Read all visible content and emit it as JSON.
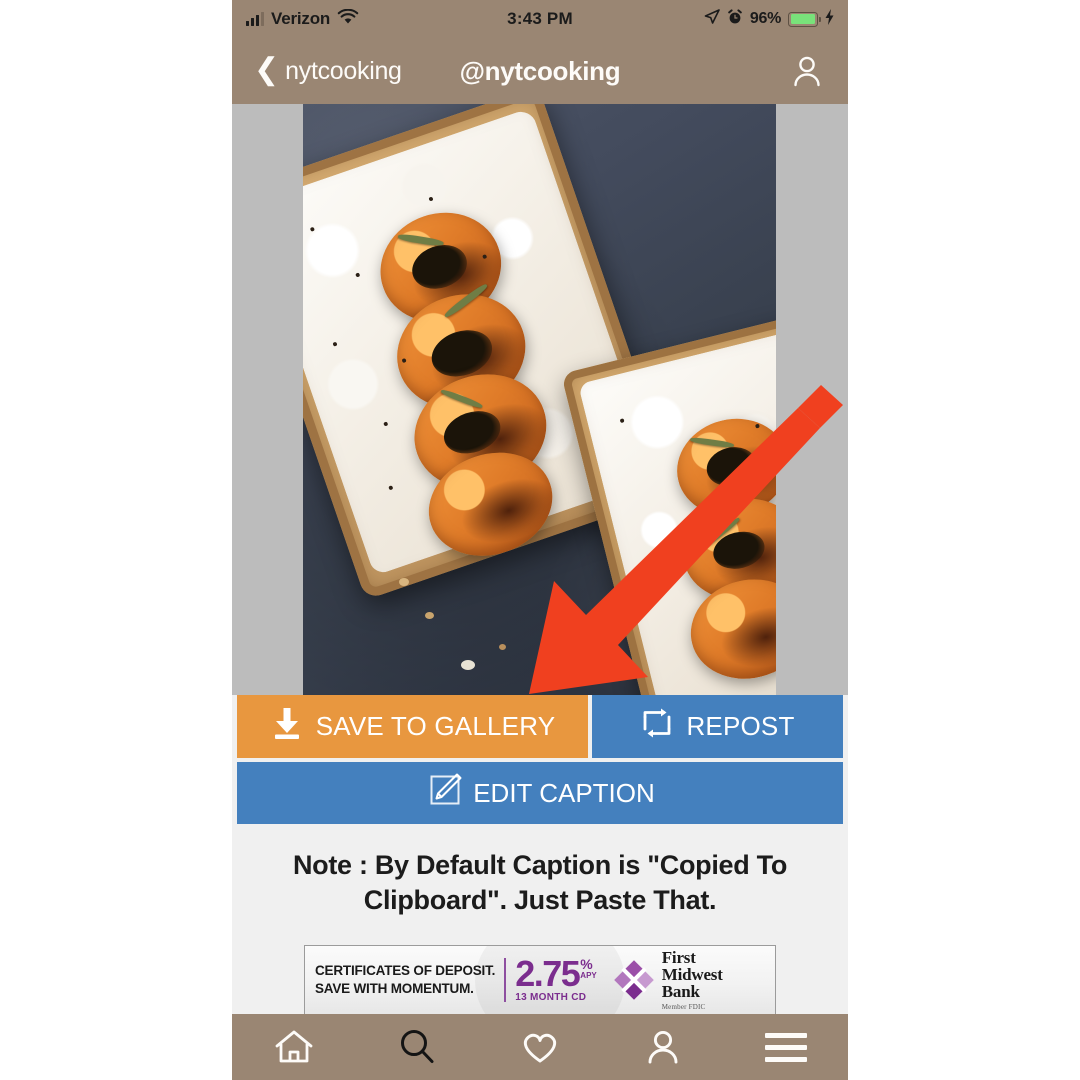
{
  "status_bar": {
    "signal_icon": "cellular-signal-icon",
    "carrier": "Verizon",
    "wifi_icon": "wifi-icon",
    "time": "3:43 PM",
    "location_icon": "location-arrow-icon",
    "alarm_icon": "alarm-clock-icon",
    "battery_percent": "96%",
    "battery_icon": "battery-icon",
    "charging_icon": "lightning-bolt-icon"
  },
  "nav_bar": {
    "back_icon": "chevron-left-icon",
    "back_label": "nytcooking",
    "title": "@nytcooking",
    "profile_icon": "person-icon"
  },
  "post": {
    "image_alt": "apricot-ricotta-toast-photo",
    "letterbox_color": "#bcbcbc"
  },
  "annotation": {
    "arrow_icon": "red-arrow-pointing-to-save-button",
    "arrow_color": "#f0401f"
  },
  "actions": {
    "save": {
      "icon": "download-icon",
      "label": "SAVE TO GALLERY",
      "color": "#e8973f"
    },
    "repost": {
      "icon": "repost-icon",
      "label": "REPOST",
      "color": "#4480be"
    },
    "edit": {
      "icon": "pencil-edit-icon",
      "label": "EDIT CAPTION",
      "color": "#4480be"
    }
  },
  "note": {
    "line1": "Note : By Default Caption is \"Copied To",
    "line2": "Clipboard\". Just Paste That."
  },
  "ad": {
    "headline_line1": "CERTIFICATES OF DEPOSIT.",
    "headline_line2": "SAVE WITH MOMENTUM.",
    "rate": "2.75",
    "rate_symbol": "%",
    "rate_apy": "APY",
    "term": "13 MONTH CD",
    "logo_icon": "first-midwest-bank-diamond-logo",
    "bank_line1": "First",
    "bank_line2": "Midwest",
    "bank_line3": "Bank",
    "fdic": "Member FDIC",
    "brand_color": "#7b2d8e"
  },
  "tab_bar": {
    "items": [
      {
        "icon": "home-icon",
        "name": "tab-home",
        "active": false
      },
      {
        "icon": "search-icon",
        "name": "tab-search",
        "active": true
      },
      {
        "icon": "heart-icon",
        "name": "tab-activity",
        "active": false
      },
      {
        "icon": "person-icon",
        "name": "tab-profile",
        "active": false
      },
      {
        "icon": "hamburger-menu-icon",
        "name": "tab-menu",
        "active": false
      }
    ]
  }
}
